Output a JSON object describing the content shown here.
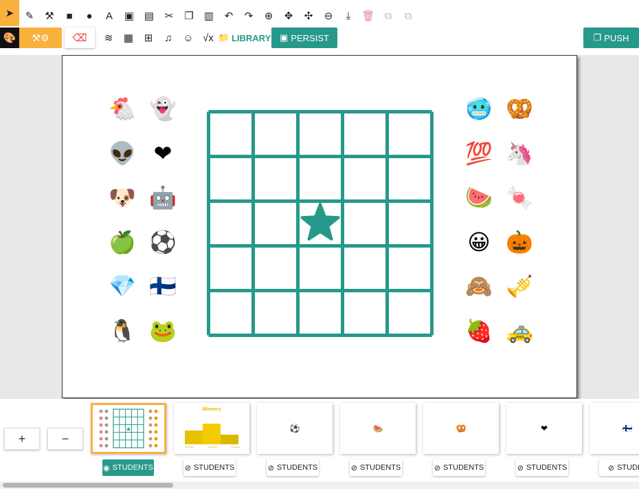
{
  "toolbar": {
    "row1_tools": [
      {
        "name": "select-tool",
        "icon": "arrow-pointer-icon",
        "glyph": "➤"
      },
      {
        "name": "pencil-tool",
        "icon": "pencil-icon",
        "glyph": "✎"
      },
      {
        "name": "magic-wand-tool",
        "icon": "magic-wand-icon",
        "glyph": "⚒"
      },
      {
        "name": "rectangle-tool",
        "icon": "square-icon",
        "glyph": "■"
      },
      {
        "name": "circle-tool",
        "icon": "circle-icon",
        "glyph": "●"
      },
      {
        "name": "text-tool",
        "icon": "text-icon",
        "glyph": "A"
      },
      {
        "name": "image-tool",
        "icon": "image-icon",
        "glyph": "▣"
      },
      {
        "name": "pdf-tool",
        "icon": "pdf-icon",
        "glyph": "▤"
      },
      {
        "name": "cut-tool",
        "icon": "scissors-icon",
        "glyph": "✂"
      },
      {
        "name": "copy-tool",
        "icon": "copy-icon",
        "glyph": "❐"
      },
      {
        "name": "paste-tool",
        "icon": "paste-icon",
        "glyph": "▥"
      },
      {
        "name": "undo-tool",
        "icon": "undo-icon",
        "glyph": "↶"
      },
      {
        "name": "redo-tool",
        "icon": "redo-icon",
        "glyph": "↷"
      },
      {
        "name": "zoom-in-tool",
        "icon": "zoom-in-icon",
        "glyph": "⊕"
      },
      {
        "name": "fit-tool",
        "icon": "compress-icon",
        "glyph": "✥"
      },
      {
        "name": "move-tool",
        "icon": "move-icon",
        "glyph": "✣"
      },
      {
        "name": "zoom-out-tool",
        "icon": "zoom-out-icon",
        "glyph": "⊖"
      },
      {
        "name": "download-tool",
        "icon": "download-icon",
        "glyph": "⤓"
      },
      {
        "name": "delete-tool",
        "icon": "trash-icon",
        "glyph": "🗑"
      },
      {
        "name": "group-tool",
        "icon": "group-icon",
        "glyph": "⧉"
      },
      {
        "name": "ungroup-tool",
        "icon": "ungroup-icon",
        "glyph": "⧉"
      }
    ],
    "row2_tools": [
      {
        "name": "layers-tool",
        "icon": "layers-icon",
        "glyph": "≋"
      },
      {
        "name": "grid-tool",
        "icon": "grid-icon",
        "glyph": "▦"
      },
      {
        "name": "table-tool",
        "icon": "table-icon",
        "glyph": "⊞"
      },
      {
        "name": "music-tool",
        "icon": "music-icon",
        "glyph": "♫"
      },
      {
        "name": "emoji-tool",
        "icon": "smile-icon",
        "glyph": "☺"
      },
      {
        "name": "math-tool",
        "icon": "square-root-icon",
        "glyph": "√x"
      }
    ],
    "library_label": "LIBRARY",
    "persist_label": "PERSIST",
    "push_label": "PUSH",
    "accent_color": "#f9b13e",
    "teal_color": "#27998a"
  },
  "slide": {
    "grid": {
      "rows": 5,
      "cols": 5,
      "color": "#27998a",
      "star_row": 3,
      "star_col": 3
    },
    "stickers_left": [
      [
        "🐔",
        "👻"
      ],
      [
        "👽",
        "❤"
      ],
      [
        "🐶",
        "🤖"
      ],
      [
        "🍏",
        "⚽"
      ],
      [
        "💎",
        "🇫🇮"
      ],
      [
        "🐧",
        "🐸"
      ]
    ],
    "stickers_right": [
      [
        "🥶",
        "🥨"
      ],
      [
        "💯",
        "🦄"
      ],
      [
        "🍉",
        "🍬"
      ],
      [
        "😀",
        "🎃"
      ],
      [
        "🙈",
        "🎺"
      ],
      [
        "🍓",
        "🚕"
      ]
    ]
  },
  "bottom": {
    "zoom_in_label": "+",
    "zoom_out_label": "−",
    "thumbnails": [
      {
        "content": "grid",
        "students_label": "STUDENTS",
        "visible": true
      },
      {
        "content": "podium",
        "title": "Winners",
        "places": [
          "2nd Place",
          "First Place",
          "3rd Place"
        ],
        "students_label": "STUDENTS",
        "visible": false
      },
      {
        "content": "⚽",
        "students_label": "STUDENTS",
        "visible": false
      },
      {
        "content": "🍉",
        "students_label": "STUDENTS",
        "visible": false
      },
      {
        "content": "🥨",
        "students_label": "STUDENTS",
        "visible": false
      },
      {
        "content": "❤",
        "students_label": "STUDENTS",
        "visible": false
      },
      {
        "content": "🇫🇮",
        "students_label": "STUDE",
        "visible": false
      }
    ]
  }
}
